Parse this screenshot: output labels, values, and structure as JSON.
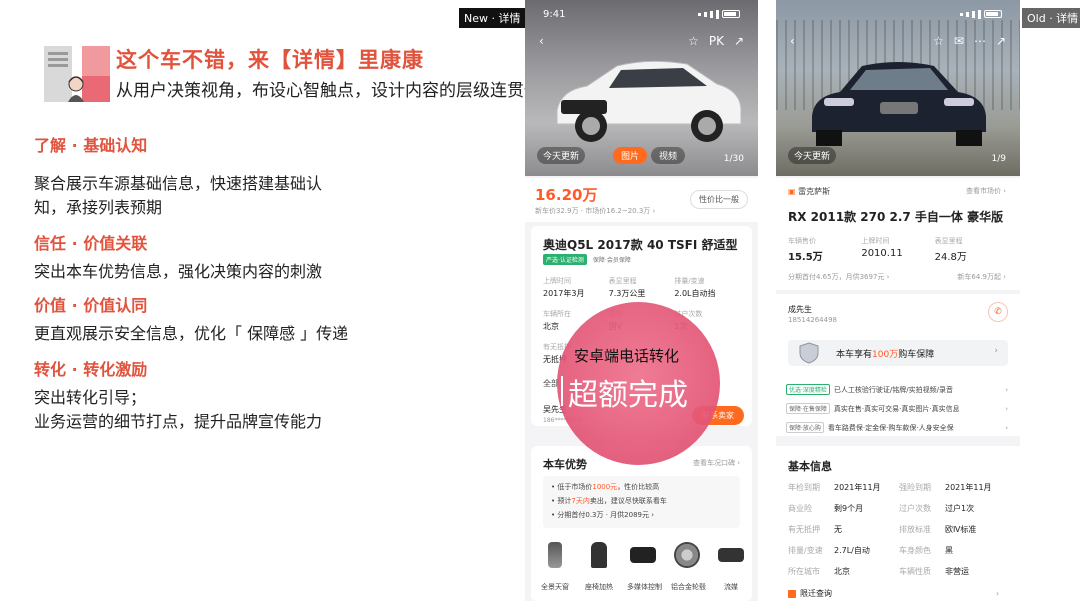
{
  "slide": {
    "title": "这个车不错，来【详情】里康康",
    "subtitle": "从用户决策视角，布设心智触点，设计内容的层级连贯性",
    "sections": [
      {
        "heading": "了解 · 基础认知",
        "body": "聚合展示车源基础信息，快速搭建基础认\n知，承接列表预期"
      },
      {
        "heading": "信任 · 价值关联",
        "body": "突出本车优势信息，强化决策内容的刺激"
      },
      {
        "heading": "价值 · 价值认同",
        "body": "更直观展示安全信息，优化「 保障感 」传递"
      },
      {
        "heading": "转化 · 转化激励",
        "body": "突出转化引导；\n业务运营的细节打点，提升品牌宣传能力"
      }
    ]
  },
  "tags": {
    "new": "New · 详情",
    "old": "Old · 详情"
  },
  "overlay": {
    "line1": "安卓端电话转化",
    "line2": "超额完成"
  },
  "new_phone": {
    "time": "9:41",
    "nav_right": [
      "☆",
      "PK",
      "↗"
    ],
    "photo_caption": "今天更新",
    "photo_tabs": [
      "图片",
      "视频"
    ],
    "photo_count": "1/30",
    "price": "16.20万",
    "price_sub": "新车价32.9万 · 市场价16.2~20.3万 ›",
    "compare_btn": "性价比一般",
    "car_title": "奥迪Q5L 2017款 40 TSFI 舒适型",
    "badges": [
      "严选·认证检测",
      "保障·会员保障"
    ],
    "specs": [
      {
        "k": "上牌时间",
        "v": "2017年3月"
      },
      {
        "k": "表显里程",
        "v": "7.3万公里"
      },
      {
        "k": "排量/变速",
        "v": "2.0L自动挡"
      },
      {
        "k": "车辆所在",
        "v": "北京"
      },
      {
        "k": "国标",
        "v": "国V"
      },
      {
        "k": "过户次数",
        "v": "1次"
      },
      {
        "k": "有无抵押",
        "v": "无抵押"
      },
      {
        "k": "",
        "v": ""
      },
      {
        "k": "",
        "v": ""
      }
    ],
    "quick_link": "全部",
    "seller": "吴先生",
    "seller_phone": "186****8123",
    "contact_btn": "联系卖家",
    "adv_title": "本车优势",
    "adv_link": "查看车况口碑 ›",
    "adv_items": [
      {
        "pre": "低于市场价",
        "hl": "1000元",
        "post": "，性价比较高"
      },
      {
        "pre": "预计",
        "hl": "7天内",
        "post": "卖出，建议尽快联系看车"
      },
      {
        "pre": "分期首付0.3万 · 月供2089元 ›",
        "hl": "",
        "post": ""
      }
    ],
    "feature_icons": [
      {
        "name": "全景天窗"
      },
      {
        "name": "座椅加热"
      },
      {
        "name": "多媒体控制"
      },
      {
        "name": "铝合金轮毂"
      },
      {
        "name": "流媒"
      }
    ]
  },
  "old_phone": {
    "photo_caption": "今天更新",
    "photo_count": "1/9",
    "brand": "雷克萨斯",
    "brand_right": "查看市场价 ›",
    "car_title": "RX 2011款 270 2.7 手自一体 豪华版",
    "specs": [
      {
        "k": "车辆售价",
        "v": "15.5万"
      },
      {
        "k": "上牌时间",
        "v": "2010.11"
      },
      {
        "k": "表显里程",
        "v": "24.8万"
      }
    ],
    "finance": "分期首付4.65万，月供3697元 ›",
    "new_price": "新车64.9万起 ›",
    "seller": "成先生",
    "seller_phone": "18514264498",
    "guarantee_pre": "本车享有",
    "guarantee_hl": "100万",
    "guarantee_post": "购车保障",
    "guarantee_rows": [
      {
        "tag": "优选·深度精检",
        "text": "已人工核验行驶证/铭牌/实拍视频/录音"
      },
      {
        "tag": "保障·在售保障",
        "text": "真实在售·真实可交易·真实图片·真实信息"
      },
      {
        "tag": "保障·放心购",
        "text": "看车路费保·定金保·购车款保·人身安全保"
      }
    ],
    "basic_title": "基本信息",
    "basic": [
      {
        "k": "年检到期",
        "v": "2021年11月"
      },
      {
        "k": "强险到期",
        "v": "2021年11月"
      },
      {
        "k": "商业险",
        "v": "剩9个月"
      },
      {
        "k": "过户次数",
        "v": "过户1次"
      },
      {
        "k": "有无抵押",
        "v": "无"
      },
      {
        "k": "排放标准",
        "v": "欧Ⅳ标准"
      },
      {
        "k": "排量/变速",
        "v": "2.7L/自动"
      },
      {
        "k": "车身颜色",
        "v": "黑"
      },
      {
        "k": "所在城市",
        "v": "北京"
      },
      {
        "k": "车辆性质",
        "v": "非营运"
      }
    ],
    "query": "限迁查询"
  }
}
